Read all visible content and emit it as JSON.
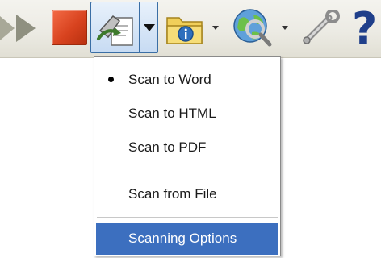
{
  "menu": {
    "items": [
      {
        "label": "Scan to Word",
        "checked": true
      },
      {
        "label": "Scan to HTML",
        "checked": false
      },
      {
        "label": "Scan to PDF",
        "checked": false
      },
      {
        "label": "Scan from File",
        "checked": false
      },
      {
        "label": "Scanning Options",
        "checked": false,
        "highlighted": true
      }
    ]
  },
  "toolbar": {
    "icons": [
      "play-icon",
      "stop-icon",
      "scan-icon",
      "folder-icon",
      "globe-icon",
      "wrench-icon",
      "help-icon"
    ],
    "help_glyph": "?"
  },
  "colors": {
    "highlight": "#3c6fbf",
    "stop_red": "#d8431f",
    "toolbar_bg": "#ecebe4",
    "menu_border": "#8a8a8a"
  }
}
